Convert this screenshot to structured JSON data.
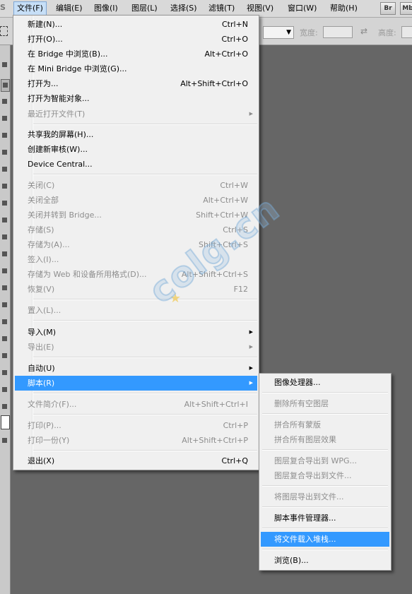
{
  "menubar": {
    "ps_fragment": "S",
    "items": [
      "文件(F)",
      "编辑(E)",
      "图像(I)",
      "图层(L)",
      "选择(S)",
      "滤镜(T)",
      "视图(V)",
      "窗口(W)",
      "帮助(H)"
    ],
    "bridge_button": "Br",
    "minibridge_button": "Mb"
  },
  "options": {
    "width_label": "宽度:",
    "height_label": "高度:",
    "swap_icon": "⇄"
  },
  "file_menu": [
    {
      "label": "新建(N)...",
      "shortcut": "Ctrl+N"
    },
    {
      "label": "打开(O)...",
      "shortcut": "Ctrl+O"
    },
    {
      "label": "在 Bridge 中浏览(B)...",
      "shortcut": "Alt+Ctrl+O"
    },
    {
      "label": "在 Mini Bridge 中浏览(G)...",
      "shortcut": ""
    },
    {
      "label": "打开为...",
      "shortcut": "Alt+Shift+Ctrl+O"
    },
    {
      "label": "打开为智能对象...",
      "shortcut": ""
    },
    {
      "label": "最近打开文件(T)",
      "shortcut": ""
    },
    {
      "label": "共享我的屏幕(H)...",
      "shortcut": ""
    },
    {
      "label": "创建新审核(W)...",
      "shortcut": ""
    },
    {
      "label": "Device Central...",
      "shortcut": ""
    },
    {
      "label": "关闭(C)",
      "shortcut": "Ctrl+W"
    },
    {
      "label": "关闭全部",
      "shortcut": "Alt+Ctrl+W"
    },
    {
      "label": "关闭并转到 Bridge...",
      "shortcut": "Shift+Ctrl+W"
    },
    {
      "label": "存储(S)",
      "shortcut": "Ctrl+S"
    },
    {
      "label": "存储为(A)...",
      "shortcut": "Shift+Ctrl+S"
    },
    {
      "label": "签入(I)...",
      "shortcut": ""
    },
    {
      "label": "存储为 Web 和设备所用格式(D)...",
      "shortcut": "Alt+Shift+Ctrl+S"
    },
    {
      "label": "恢复(V)",
      "shortcut": "F12"
    },
    {
      "label": "置入(L)...",
      "shortcut": ""
    },
    {
      "label": "导入(M)",
      "shortcut": ""
    },
    {
      "label": "导出(E)",
      "shortcut": ""
    },
    {
      "label": "自动(U)",
      "shortcut": ""
    },
    {
      "label": "脚本(R)",
      "shortcut": ""
    },
    {
      "label": "文件简介(F)...",
      "shortcut": "Alt+Shift+Ctrl+I"
    },
    {
      "label": "打印(P)...",
      "shortcut": "Ctrl+P"
    },
    {
      "label": "打印一份(Y)",
      "shortcut": "Alt+Shift+Ctrl+P"
    },
    {
      "label": "退出(X)",
      "shortcut": "Ctrl+Q"
    }
  ],
  "scripts_submenu": [
    {
      "label": "图像处理器..."
    },
    {
      "label": "删除所有空图层"
    },
    {
      "label": "拼合所有蒙版"
    },
    {
      "label": "拼合所有图层效果"
    },
    {
      "label": "图层复合导出到 WPG..."
    },
    {
      "label": "图层复合导出到文件..."
    },
    {
      "label": "将图层导出到文件..."
    },
    {
      "label": "脚本事件管理器..."
    },
    {
      "label": "将文件载入堆栈..."
    },
    {
      "label": "浏览(B)..."
    }
  ],
  "watermark": "colg.cn",
  "colors": {
    "highlight": "#3399ff",
    "menu_bg": "#f0f0f0",
    "workspace": "#666666",
    "disabled_text": "#8d8d8d"
  }
}
